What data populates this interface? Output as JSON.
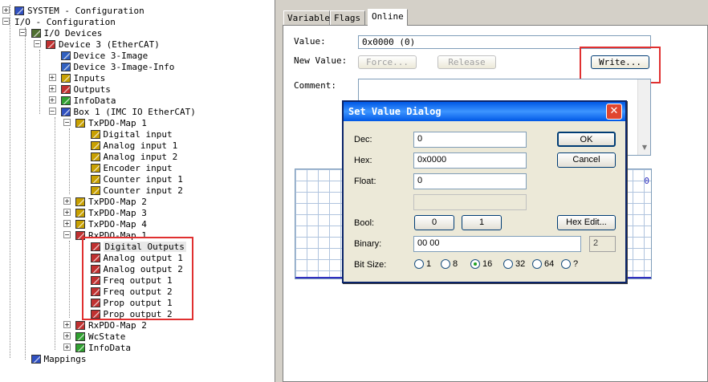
{
  "tree": {
    "items": [
      {
        "label": "SYSTEM - Configuration",
        "icon": "system-icon"
      },
      {
        "label": "I/O - Configuration",
        "icon": "none"
      },
      {
        "label": "I/O Devices",
        "icon": "io-devices-icon"
      },
      {
        "label": "Device 3 (EtherCAT)",
        "icon": "ethercat-device-icon"
      },
      {
        "label": "Device 3-Image",
        "icon": "image-icon"
      },
      {
        "label": "Device 3-Image-Info",
        "icon": "image-info-icon"
      },
      {
        "label": "Inputs",
        "icon": "inputs-icon"
      },
      {
        "label": "Outputs",
        "icon": "outputs-icon"
      },
      {
        "label": "InfoData",
        "icon": "infodata-icon"
      },
      {
        "label": "Box 1 (IMC IO EtherCAT)",
        "icon": "box-icon"
      },
      {
        "label": "TxPDO-Map 1",
        "icon": "pdo-map-icon"
      },
      {
        "label": "Digital input",
        "icon": "input-var-icon"
      },
      {
        "label": "Analog input 1",
        "icon": "input-var-icon"
      },
      {
        "label": "Analog input 2",
        "icon": "input-var-icon"
      },
      {
        "label": "Encoder input",
        "icon": "input-var-icon"
      },
      {
        "label": "Counter input 1",
        "icon": "input-var-icon"
      },
      {
        "label": "Counter input 2",
        "icon": "input-var-icon"
      },
      {
        "label": "TxPDO-Map 2",
        "icon": "pdo-map-icon"
      },
      {
        "label": "TxPDO-Map 3",
        "icon": "pdo-map-icon"
      },
      {
        "label": "TxPDO-Map 4",
        "icon": "pdo-map-icon"
      },
      {
        "label": "RxPDO-Map 1",
        "icon": "pdo-map-out-icon"
      },
      {
        "label": "Digital Outputs",
        "icon": "output-var-icon"
      },
      {
        "label": "Analog output 1",
        "icon": "output-var-icon"
      },
      {
        "label": "Analog output 2",
        "icon": "output-var-icon"
      },
      {
        "label": "Freq output 1",
        "icon": "output-var-icon"
      },
      {
        "label": "Freq output 2",
        "icon": "output-var-icon"
      },
      {
        "label": "Prop output 1",
        "icon": "output-var-icon"
      },
      {
        "label": "Prop output 2",
        "icon": "output-var-icon"
      },
      {
        "label": "RxPDO-Map 2",
        "icon": "pdo-map-out-icon"
      },
      {
        "label": "WcState",
        "icon": "wcstate-icon"
      },
      {
        "label": "InfoData",
        "icon": "infodata-icon"
      },
      {
        "label": "Mappings",
        "icon": "mappings-icon"
      }
    ]
  },
  "tabs": [
    "Variable",
    "Flags",
    "Online"
  ],
  "online": {
    "value_label": "Value:",
    "value": "0x0000  (0)",
    "new_value_label": "New Value:",
    "force_label": "Force...",
    "release_label": "Release",
    "write_label": "Write...",
    "comment_label": "Comment:",
    "chart_value": "0"
  },
  "dialog": {
    "title": "Set Value Dialog",
    "dec_label": "Dec:",
    "dec_value": "0",
    "hex_label": "Hex:",
    "hex_value": "0x0000",
    "float_label": "Float:",
    "float_value": "0",
    "bool_label": "Bool:",
    "bool_0": "0",
    "bool_1": "1",
    "ok_label": "OK",
    "cancel_label": "Cancel",
    "hex_edit_label": "Hex Edit...",
    "binary_label": "Binary:",
    "binary_value": "00 00",
    "binary_len": "2",
    "bitsize_label": "Bit Size:",
    "bitsizes": [
      "1",
      "8",
      "16",
      "32",
      "64",
      "?"
    ],
    "selected_bitsize": "16"
  },
  "colors": {
    "highlight_box": "#e03030",
    "titlebar": "#0058e6",
    "grid": "#b0c4de"
  }
}
